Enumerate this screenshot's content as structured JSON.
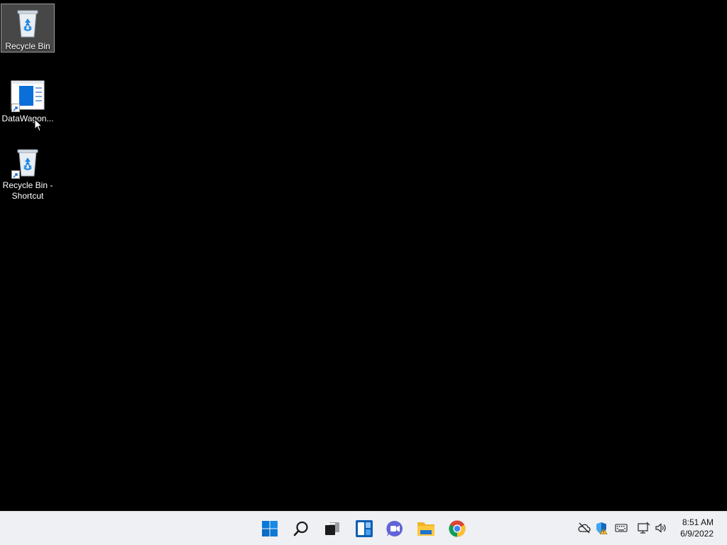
{
  "desktop": {
    "icons": [
      {
        "label": "Recycle Bin",
        "icon": "recycle-bin-icon",
        "selected": true
      },
      {
        "label": "DataWagon...",
        "icon": "app-window-icon",
        "shortcut": true
      },
      {
        "label_line1": "Recycle Bin -",
        "label_line2": "Shortcut",
        "icon": "recycle-bin-icon",
        "shortcut": true
      }
    ]
  },
  "taskbar": {
    "pinned": [
      {
        "icon": "windows-start-icon"
      },
      {
        "icon": "search-icon"
      },
      {
        "icon": "task-view-icon"
      },
      {
        "icon": "widgets-icon"
      },
      {
        "icon": "teams-chat-icon"
      },
      {
        "icon": "file-explorer-icon"
      },
      {
        "icon": "chrome-icon"
      }
    ],
    "tray": [
      {
        "icon": "onedrive-offline-icon"
      },
      {
        "icon": "security-warning-icon"
      },
      {
        "icon": "keyboard-icon"
      },
      {
        "icon": "network-icon"
      },
      {
        "icon": "volume-icon"
      }
    ],
    "clock": {
      "time": "8:51 AM",
      "date": "6/9/2022"
    }
  },
  "colors": {
    "desktop_bg": "#000000",
    "taskbar_bg": "#eef0f3",
    "accent_blue": "#0078d4"
  }
}
